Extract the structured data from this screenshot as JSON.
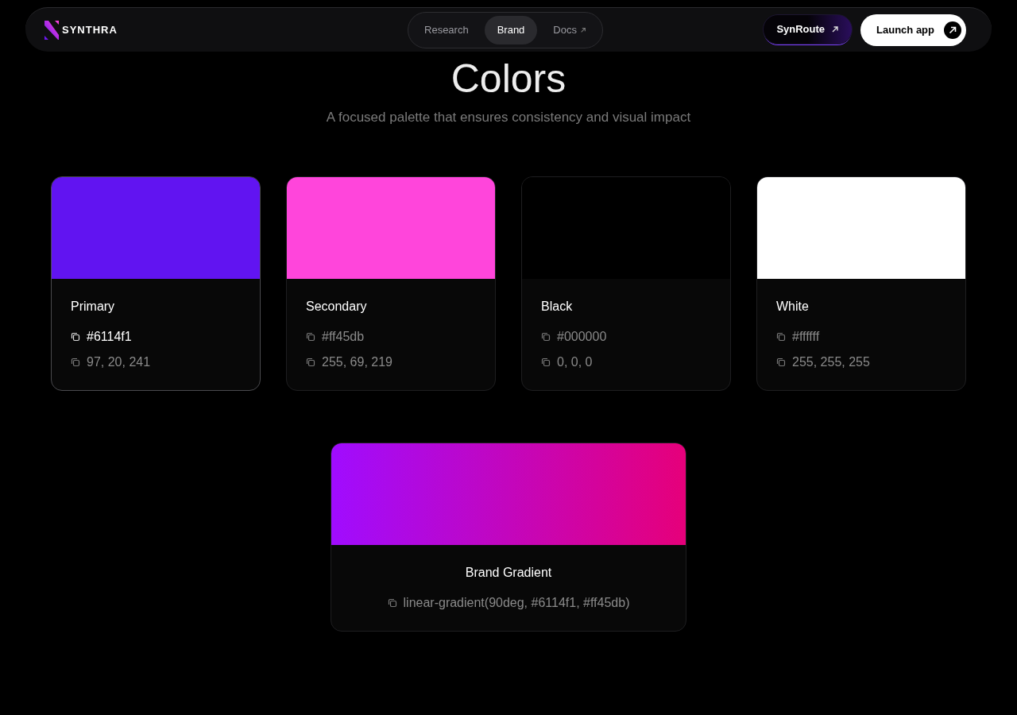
{
  "nav": {
    "brand": "SYNTHRA",
    "links": [
      {
        "label": "Research",
        "selected": false,
        "external": false
      },
      {
        "label": "Brand",
        "selected": true,
        "external": false
      },
      {
        "label": "Docs",
        "selected": false,
        "external": true
      }
    ],
    "secondary_button": "SynRoute",
    "primary_button": "Launch app"
  },
  "heading": "Colors",
  "subtitle": "A focused palette that ensures consistency and visual impact",
  "swatches": [
    {
      "name": "Primary",
      "color": "#6114f1",
      "hex": "#6114f1",
      "rgb": "97, 20, 241",
      "selected": true
    },
    {
      "name": "Secondary",
      "color": "#ff45db",
      "hex": "#ff45db",
      "rgb": "255, 69, 219",
      "selected": false
    },
    {
      "name": "Black",
      "color": "#000000",
      "hex": "#000000",
      "rgb": "0, 0, 0",
      "selected": false
    },
    {
      "name": "White",
      "color": "#ffffff",
      "hex": "#ffffff",
      "rgb": "255, 255, 255",
      "selected": false
    }
  ],
  "gradient": {
    "name": "Brand Gradient",
    "stops": [
      {
        "color": "#a00cff"
      },
      {
        "color": "#e6007a"
      }
    ],
    "value": "linear-gradient(90deg, #6114f1, #ff45db)"
  }
}
